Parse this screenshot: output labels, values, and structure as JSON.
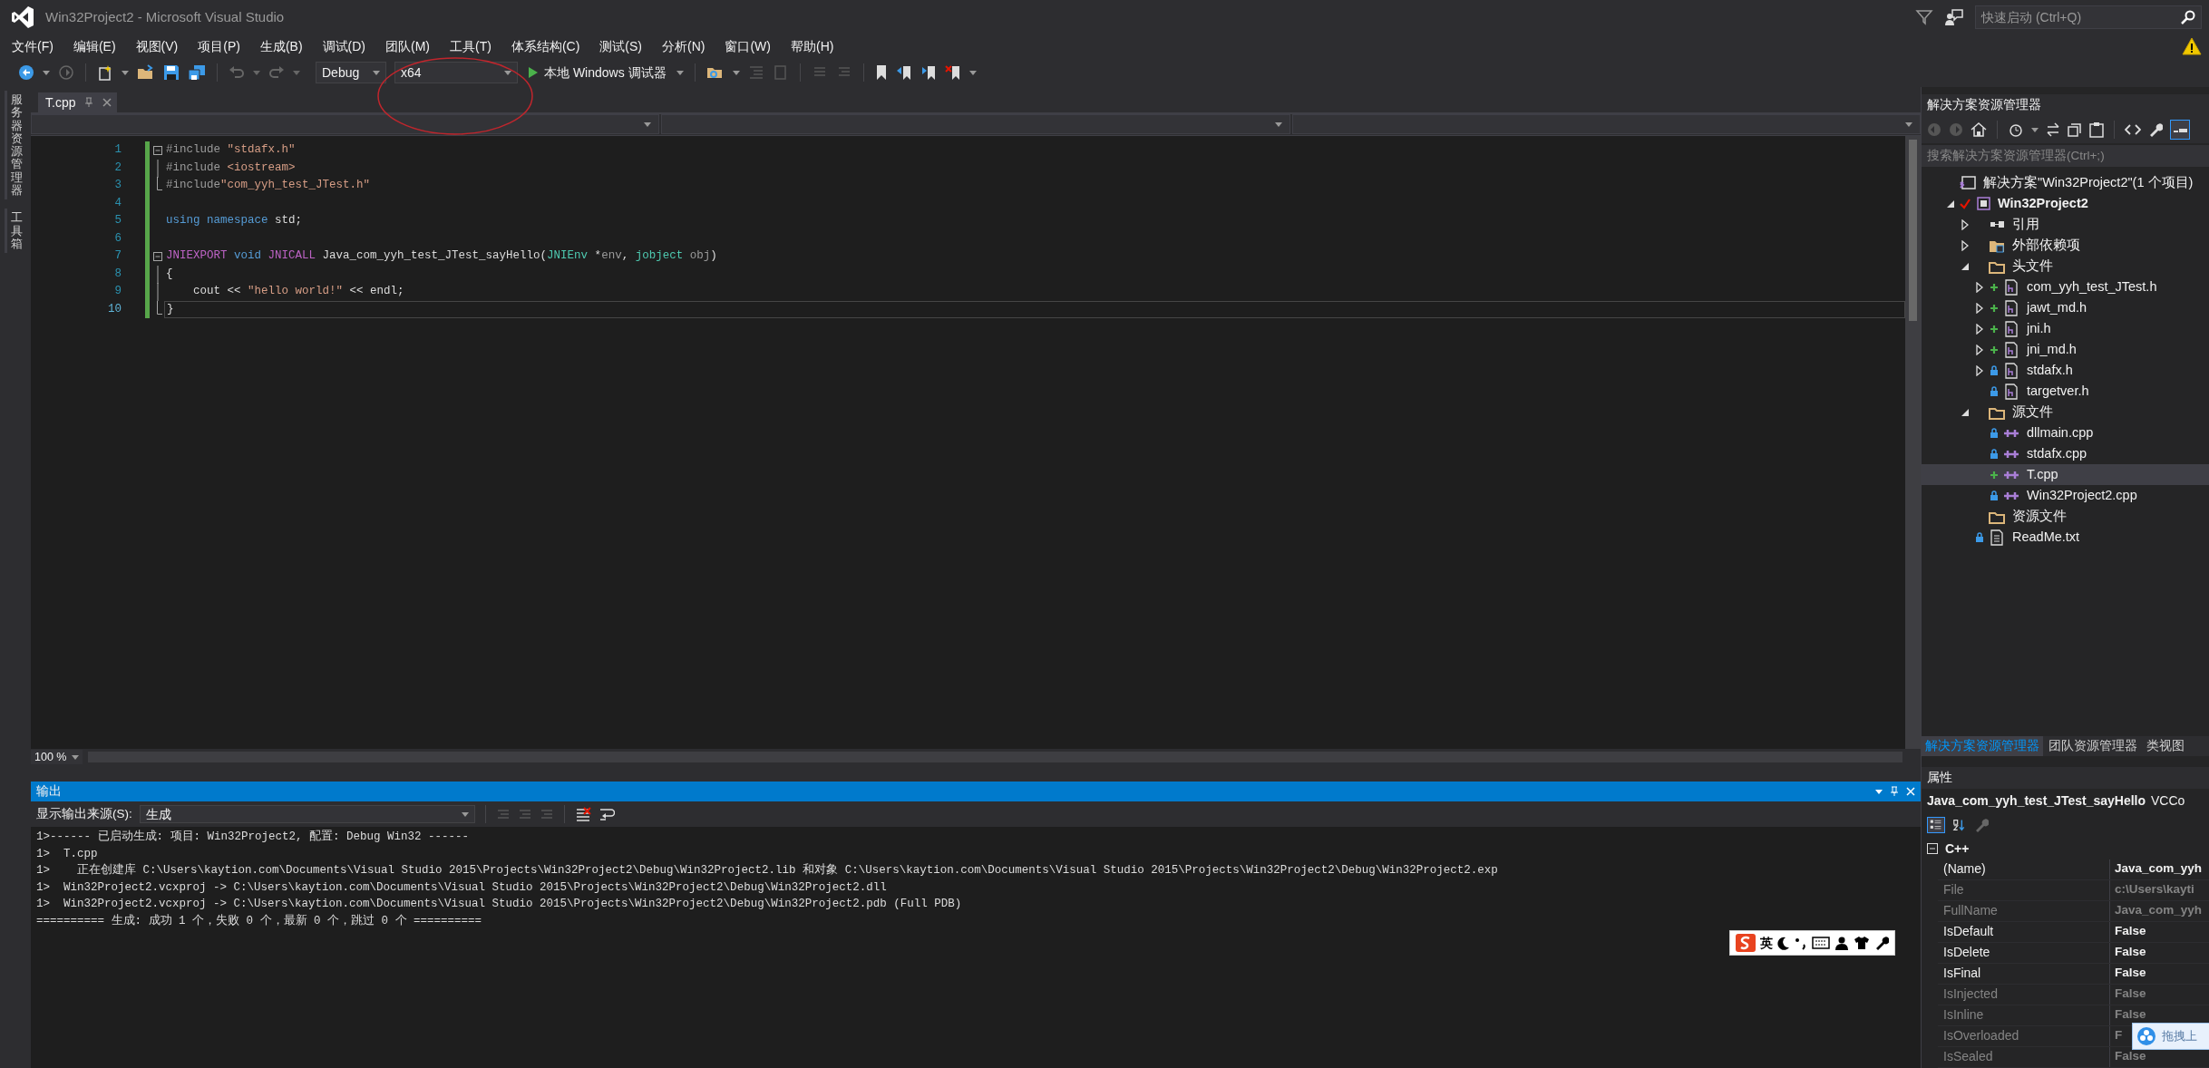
{
  "window": {
    "title": "Win32Project2 - Microsoft Visual Studio"
  },
  "quick_launch": {
    "placeholder": "快速启动 (Ctrl+Q)"
  },
  "menu": [
    "文件(F)",
    "编辑(E)",
    "视图(V)",
    "项目(P)",
    "生成(B)",
    "调试(D)",
    "团队(M)",
    "工具(T)",
    "体系结构(C)",
    "测试(S)",
    "分析(N)",
    "窗口(W)",
    "帮助(H)"
  ],
  "toolbar": {
    "configuration": "Debug",
    "platform": "x64",
    "debugger": "本地 Windows 调试器"
  },
  "side_tabs": [
    "服务器资源管理器",
    "工具箱"
  ],
  "editor": {
    "tabs": [
      {
        "label": "T.cpp",
        "selected": true
      }
    ],
    "lines": [
      {
        "number": "1",
        "collapsible": true,
        "outlined": true,
        "changed": true,
        "current": false,
        "tokens": [
          {
            "kind": "preproc",
            "text": "#include "
          },
          {
            "kind": "string",
            "text": "\"stdafx.h\""
          }
        ]
      },
      {
        "number": "2",
        "collapsible": false,
        "outlined": true,
        "changed": true,
        "current": false,
        "tokens": [
          {
            "kind": "preproc",
            "text": "#include "
          },
          {
            "kind": "string",
            "text": "<iostream>"
          }
        ]
      },
      {
        "number": "3",
        "collapsible": false,
        "outlined": true,
        "changed": true,
        "current": false,
        "tokens": [
          {
            "kind": "preproc",
            "text": "#include"
          },
          {
            "kind": "string",
            "text": "\"com_yyh_test_JTest.h\""
          }
        ]
      },
      {
        "number": "4",
        "collapsible": false,
        "outlined": false,
        "changed": true,
        "current": false
      },
      {
        "number": "5",
        "collapsible": false,
        "outlined": false,
        "changed": true,
        "current": false,
        "tokens": [
          {
            "kind": "keyword",
            "text": "using "
          },
          {
            "kind": "keyword",
            "text": "namespace"
          },
          {
            "kind": "plain",
            "text": " std;"
          }
        ]
      },
      {
        "number": "6",
        "collapsible": false,
        "outlined": false,
        "changed": true,
        "current": false
      },
      {
        "number": "7",
        "collapsible": true,
        "outlined": true,
        "changed": true,
        "current": false,
        "tokens": [
          {
            "kind": "macro",
            "text": "JNIEXPORT"
          },
          {
            "kind": "keyword",
            "text": " void"
          },
          {
            "kind": "macro",
            "text": " JNICALL"
          },
          {
            "kind": "plain",
            "text": " Java_com_yyh_test_JTest_sayHello("
          },
          {
            "kind": "type",
            "text": "JNIEnv"
          },
          {
            "kind": "plain",
            "text": " *"
          },
          {
            "kind": "param",
            "text": "env"
          },
          {
            "kind": "plain",
            "text": ", "
          },
          {
            "kind": "type",
            "text": "jobject"
          },
          {
            "kind": "param",
            "text": " obj"
          },
          {
            "kind": "plain",
            "text": ")"
          }
        ]
      },
      {
        "number": "8",
        "collapsible": false,
        "outlined": true,
        "changed": true,
        "current": false,
        "tokens": [
          {
            "kind": "plain",
            "text": "{"
          }
        ]
      },
      {
        "number": "9",
        "collapsible": false,
        "outlined": true,
        "changed": true,
        "current": false,
        "tokens": [
          {
            "kind": "plain",
            "text": "    cout << "
          },
          {
            "kind": "string",
            "text": "\"hello world!\""
          },
          {
            "kind": "plain",
            "text": " << endl;"
          }
        ]
      },
      {
        "number": "10",
        "collapsible": false,
        "outlined": true,
        "changed": true,
        "current": true,
        "tokens": [
          {
            "kind": "plain",
            "text": "}"
          }
        ]
      }
    ],
    "zoom": "100 %"
  },
  "output": {
    "title": "输出",
    "source_label": "显示输出来源(S):",
    "source": "生成",
    "lines": [
      "1>------ 已启动生成: 项目: Win32Project2, 配置: Debug Win32 ------",
      "1>  T.cpp",
      "1>    正在创建库 C:\\Users\\kaytion.com\\Documents\\Visual Studio 2015\\Projects\\Win32Project2\\Debug\\Win32Project2.lib 和对象 C:\\Users\\kaytion.com\\Documents\\Visual Studio 2015\\Projects\\Win32Project2\\Debug\\Win32Project2.exp",
      "1>  Win32Project2.vcxproj -> C:\\Users\\kaytion.com\\Documents\\Visual Studio 2015\\Projects\\Win32Project2\\Debug\\Win32Project2.dll",
      "1>  Win32Project2.vcxproj -> C:\\Users\\kaytion.com\\Documents\\Visual Studio 2015\\Projects\\Win32Project2\\Debug\\Win32Project2.pdb (Full PDB)",
      "========== 生成: 成功 1 个，失败 0 个，最新 0 个，跳过 0 个 =========="
    ]
  },
  "ime_bar": {
    "mode": "英"
  },
  "solution_explorer": {
    "title": "解决方案资源管理器",
    "search": {
      "placeholder": "搜索解决方案资源管理器(Ctrl+;)"
    },
    "tree": [
      {
        "label": "解决方案\"Win32Project2\"(1 个项目)",
        "kind": "solution",
        "added": false,
        "locked": false,
        "checked_out": false,
        "selected": false,
        "children": [
          {
            "label": "Win32Project2",
            "kind": "project",
            "added": false,
            "locked": false,
            "checked_out": true,
            "expanded": true,
            "selected": false,
            "children": [
              {
                "label": "引用",
                "kind": "references",
                "added": false,
                "locked": false,
                "checked_out": false,
                "expanded": false,
                "selected": false
              },
              {
                "label": "外部依赖项",
                "kind": "external",
                "added": false,
                "locked": false,
                "checked_out": false,
                "expanded": false,
                "selected": false
              },
              {
                "label": "头文件",
                "kind": "folder",
                "added": false,
                "locked": false,
                "checked_out": false,
                "expanded": true,
                "selected": false,
                "children": [
                  {
                    "label": "com_yyh_test_JTest.h",
                    "kind": "header",
                    "added": true,
                    "locked": false,
                    "checked_out": false,
                    "expanded": false,
                    "selected": false
                  },
                  {
                    "label": "jawt_md.h",
                    "kind": "header",
                    "added": true,
                    "locked": false,
                    "checked_out": false,
                    "expanded": false,
                    "selected": false
                  },
                  {
                    "label": "jni.h",
                    "kind": "header",
                    "added": true,
                    "locked": false,
                    "checked_out": false,
                    "expanded": false,
                    "selected": false
                  },
                  {
                    "label": "jni_md.h",
                    "kind": "header",
                    "added": true,
                    "locked": false,
                    "checked_out": false,
                    "expanded": false,
                    "selected": false
                  },
                  {
                    "label": "stdafx.h",
                    "kind": "header",
                    "added": false,
                    "locked": true,
                    "checked_out": false,
                    "expanded": false,
                    "selected": false
                  },
                  {
                    "label": "targetver.h",
                    "kind": "header",
                    "added": false,
                    "locked": true,
                    "checked_out": false,
                    "selected": false
                  }
                ]
              },
              {
                "label": "源文件",
                "kind": "folder",
                "added": false,
                "locked": false,
                "checked_out": false,
                "expanded": true,
                "selected": false,
                "children": [
                  {
                    "label": "dllmain.cpp",
                    "kind": "cpp",
                    "added": false,
                    "locked": true,
                    "checked_out": false,
                    "selected": false
                  },
                  {
                    "label": "stdafx.cpp",
                    "kind": "cpp",
                    "added": false,
                    "locked": true,
                    "checked_out": false,
                    "selected": false
                  },
                  {
                    "label": "T.cpp",
                    "kind": "cpp",
                    "added": true,
                    "locked": false,
                    "checked_out": false,
                    "selected": true
                  },
                  {
                    "label": "Win32Project2.cpp",
                    "kind": "cpp",
                    "added": false,
                    "locked": true,
                    "checked_out": false,
                    "selected": false
                  }
                ]
              },
              {
                "label": "资源文件",
                "kind": "folder",
                "added": false,
                "locked": false,
                "checked_out": false,
                "selected": false
              },
              {
                "label": "ReadMe.txt",
                "kind": "text",
                "added": false,
                "locked": true,
                "checked_out": false,
                "selected": false
              }
            ]
          }
        ]
      }
    ]
  },
  "panel_tabs": [
    {
      "label": "解决方案资源管理器",
      "selected": true
    },
    {
      "label": "团队资源管理器",
      "selected": false
    },
    {
      "label": "类视图",
      "selected": false
    }
  ],
  "properties": {
    "title": "属性",
    "object_name": "Java_com_yyh_test_JTest_sayHello",
    "object_type": "VCCo",
    "view_modes": [
      {
        "kind": "categorized",
        "selected": true
      },
      {
        "kind": "alphabetical",
        "selected": false
      }
    ],
    "category": {
      "name": "C++",
      "expanded": true
    },
    "rows": [
      {
        "name": "(Name)",
        "value": "Java_com_yyh",
        "readonly": false
      },
      {
        "name": "File",
        "value": "c:\\Users\\kayti",
        "readonly": true
      },
      {
        "name": "FullName",
        "value": "Java_com_yyh",
        "readonly": true
      },
      {
        "name": "IsDefault",
        "value": "False",
        "readonly": false
      },
      {
        "name": "IsDelete",
        "value": "False",
        "readonly": false
      },
      {
        "name": "IsFinal",
        "value": "False",
        "readonly": false
      },
      {
        "name": "IsInjected",
        "value": "False",
        "readonly": true
      },
      {
        "name": "IsInline",
        "value": "False",
        "readonly": true
      },
      {
        "name": "IsOverloaded",
        "value": "F",
        "readonly": true
      },
      {
        "name": "IsSealed",
        "value": "False",
        "readonly": true
      }
    ]
  },
  "upload_popup": {
    "text": "拖拽上"
  }
}
